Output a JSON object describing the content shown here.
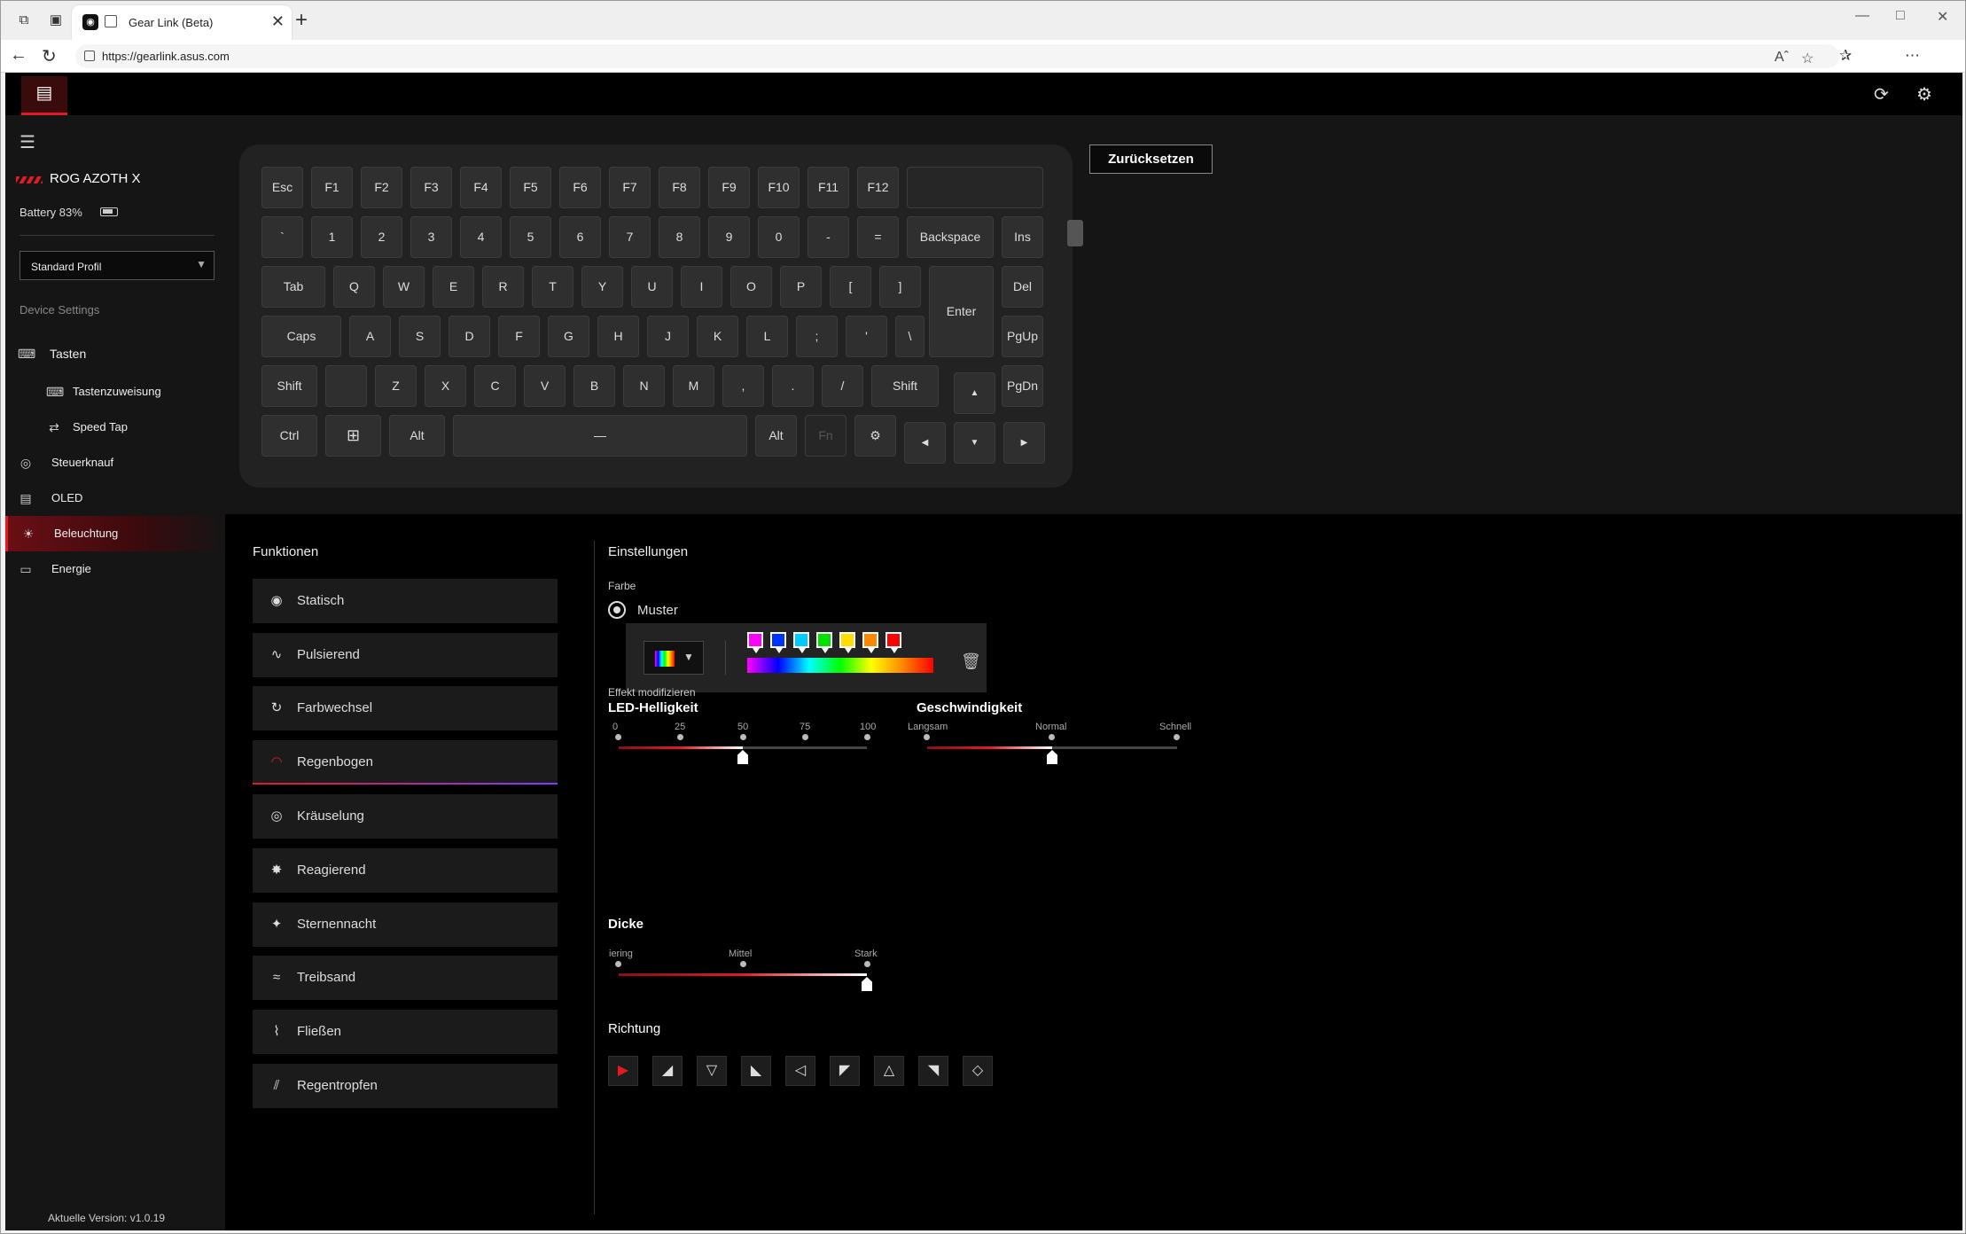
{
  "browser": {
    "tab_title": "Gear Link (Beta)",
    "url": "https://gearlink.asus.com",
    "read_aloud": "Aˆ"
  },
  "header": {
    "logo_icon": "device-icon",
    "sync_icon": "sync-icon",
    "settings_icon": "gear-icon"
  },
  "sidebar": {
    "device_name": "ROG AZOTH X",
    "battery_label": "Battery 83%",
    "profile": "Standard Profil",
    "section_label": "Device Settings",
    "items": [
      {
        "label": "Tasten",
        "icon": "fn-key-icon"
      },
      {
        "label": "Tastenzuweisung",
        "icon": "keyboard-icon"
      },
      {
        "label": "Speed Tap",
        "icon": "speed-tap-icon"
      },
      {
        "label": "Steuerknauf",
        "icon": "knob-icon"
      },
      {
        "label": "OLED",
        "icon": "oled-icon"
      },
      {
        "label": "Beleuchtung",
        "icon": "lighting-icon"
      },
      {
        "label": "Energie",
        "icon": "battery-icon"
      }
    ],
    "version": "Aktuelle Version: v1.0.19"
  },
  "keyboard": {
    "rows": [
      [
        "Esc",
        "F1",
        "F2",
        "F3",
        "F4",
        "F5",
        "F6",
        "F7",
        "F8",
        "F9",
        "F10",
        "F11",
        "F12",
        ""
      ],
      [
        "`",
        "1",
        "2",
        "3",
        "4",
        "5",
        "6",
        "7",
        "8",
        "9",
        "0",
        "-",
        "=",
        "Backspace",
        "Ins"
      ],
      [
        "Tab",
        "Q",
        "W",
        "E",
        "R",
        "T",
        "Y",
        "U",
        "I",
        "O",
        "P",
        "[",
        "]",
        "Enter",
        "Del"
      ],
      [
        "Caps",
        "A",
        "S",
        "D",
        "F",
        "G",
        "H",
        "J",
        "K",
        "L",
        ";",
        "'",
        "\\",
        "PgUp"
      ],
      [
        "Shift",
        "",
        "Z",
        "X",
        "C",
        "V",
        "B",
        "N",
        "M",
        ",",
        ".",
        "/",
        "Shift",
        "▲",
        "PgDn"
      ],
      [
        "Ctrl",
        "⊞",
        "Alt",
        "—",
        "Alt",
        "Fn",
        "⚙",
        "◀",
        "▼",
        "▶"
      ]
    ]
  },
  "reset_label": "Zurücksetzen",
  "functions": {
    "title": "Funktionen",
    "items": [
      {
        "label": "Statisch",
        "icon": "static-icon"
      },
      {
        "label": "Pulsierend",
        "icon": "pulse-icon"
      },
      {
        "label": "Farbwechsel",
        "icon": "color-cycle-icon"
      },
      {
        "label": "Regenbogen",
        "icon": "rainbow-icon"
      },
      {
        "label": "Kräuselung",
        "icon": "ripple-icon"
      },
      {
        "label": "Reagierend",
        "icon": "reactive-icon"
      },
      {
        "label": "Sternennacht",
        "icon": "starry-night-icon"
      },
      {
        "label": "Treibsand",
        "icon": "quicksand-icon"
      },
      {
        "label": "Fließen",
        "icon": "flow-icon"
      },
      {
        "label": "Regentropfen",
        "icon": "raindrop-icon"
      }
    ],
    "selected": "Regenbogen"
  },
  "settings": {
    "title": "Einstellungen",
    "color_label": "Farbe",
    "pattern_label": "Muster",
    "palette_colors": [
      "#ff00ff",
      "#0033ff",
      "#00ccff",
      "#00e000",
      "#ffdd00",
      "#ff8800",
      "#ff0000"
    ],
    "effect_label": "Effekt modifizieren",
    "brightness": {
      "title": "LED-Helligkeit",
      "ticks": [
        "0",
        "25",
        "50",
        "75",
        "100"
      ],
      "value": 50
    },
    "speed": {
      "title": "Geschwindigkeit",
      "ticks": [
        "Langsam",
        "Normal",
        "Schnell"
      ],
      "value": "Normal"
    },
    "thickness": {
      "title": "Dicke",
      "ticks": [
        "iering",
        "Mittel",
        "Stark"
      ],
      "value": "Stark"
    },
    "direction": {
      "title": "Richtung",
      "options": [
        "▶",
        "◢",
        "▽",
        "◣",
        "◁",
        "◤",
        "△",
        "◥",
        "◇"
      ],
      "selected_index": 0
    }
  },
  "colors": {
    "accent": "#e01b24",
    "bg": "#000000",
    "panel": "#151515"
  }
}
